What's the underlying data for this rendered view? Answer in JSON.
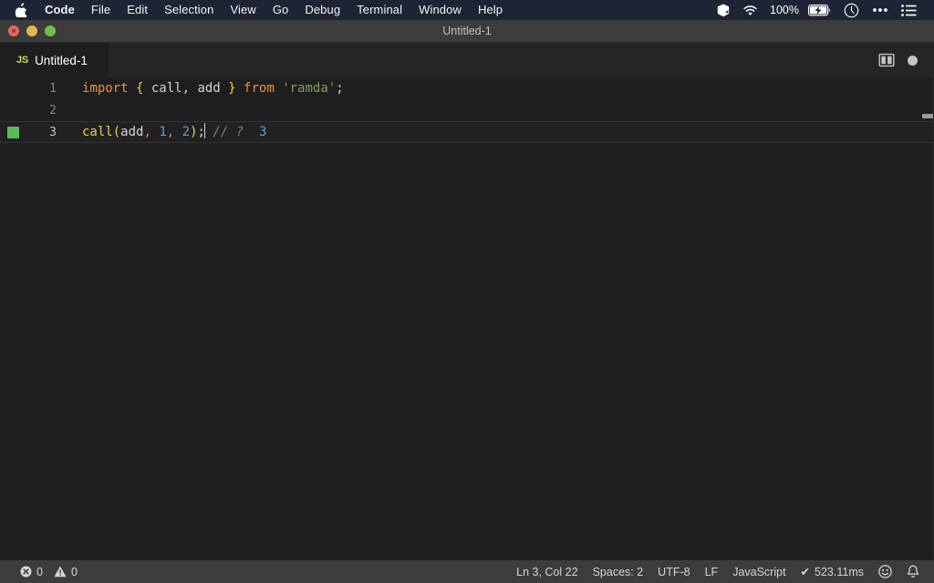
{
  "menubar": {
    "apple_icon": "apple-logo",
    "items": [
      {
        "label": "Code",
        "bold": true
      },
      {
        "label": "File",
        "bold": false
      },
      {
        "label": "Edit",
        "bold": false
      },
      {
        "label": "Selection",
        "bold": false
      },
      {
        "label": "View",
        "bold": false
      },
      {
        "label": "Go",
        "bold": false
      },
      {
        "label": "Debug",
        "bold": false
      },
      {
        "label": "Terminal",
        "bold": false
      },
      {
        "label": "Window",
        "bold": false
      },
      {
        "label": "Help",
        "bold": false
      }
    ],
    "status": {
      "dropbox_icon": "box-icon",
      "wifi_icon": "wifi-icon",
      "battery_percent": "100%",
      "battery_icon": "battery-charging-icon",
      "clock_icon": "time-machine-icon",
      "overflow_icon": "ellipsis-icon",
      "list_icon": "list-icon"
    }
  },
  "window": {
    "title": "Untitled-1",
    "traffic_lights": [
      "close",
      "minimize",
      "zoom"
    ]
  },
  "tabbar": {
    "tab": {
      "file_type": "JS",
      "label": "Untitled-1"
    },
    "actions": {
      "split_editor_icon": "split-editor-icon",
      "unsaved_dot": "unsaved-indicator-dot"
    }
  },
  "editor": {
    "lines": [
      {
        "number": "1",
        "has_marker": false,
        "active": false,
        "tokens": [
          {
            "text": "import",
            "type": "keyword"
          },
          {
            "text": " ",
            "type": "plain"
          },
          {
            "text": "{",
            "type": "brace"
          },
          {
            "text": " call, add ",
            "type": "plain"
          },
          {
            "text": "}",
            "type": "brace"
          },
          {
            "text": " ",
            "type": "plain"
          },
          {
            "text": "from",
            "type": "keyword"
          },
          {
            "text": " ",
            "type": "plain"
          },
          {
            "text": "'ramda'",
            "type": "string"
          },
          {
            "text": ";",
            "type": "semi"
          }
        ]
      },
      {
        "number": "2",
        "has_marker": false,
        "active": false,
        "tokens": []
      },
      {
        "number": "3",
        "has_marker": true,
        "active": true,
        "tokens": [
          {
            "text": "call",
            "type": "func"
          },
          {
            "text": "(",
            "type": "punct"
          },
          {
            "text": "add",
            "type": "plain"
          },
          {
            "text": ",",
            "type": "comma"
          },
          {
            "text": " ",
            "type": "plain"
          },
          {
            "text": "1",
            "type": "number"
          },
          {
            "text": ",",
            "type": "comma"
          },
          {
            "text": " ",
            "type": "plain"
          },
          {
            "text": "2",
            "type": "number"
          },
          {
            "text": ")",
            "type": "punct"
          },
          {
            "text": ";",
            "type": "semi"
          },
          {
            "text": " ",
            "type": "plain"
          },
          {
            "text": "// ?",
            "type": "comment"
          },
          {
            "text": "  ",
            "type": "plain"
          },
          {
            "text": "3",
            "type": "result"
          }
        ]
      }
    ]
  },
  "statusbar": {
    "errors_icon": "error-circle-icon",
    "errors_count": "0",
    "warnings_icon": "warning-triangle-icon",
    "warnings_count": "0",
    "cursor_position": "Ln 3, Col 22",
    "indentation": "Spaces: 2",
    "encoding": "UTF-8",
    "eol": "LF",
    "language": "JavaScript",
    "runtime_check": "✔",
    "runtime_time": "523.11ms",
    "feedback_icon": "smiley-icon",
    "notifications_icon": "bell-icon"
  },
  "colors": {
    "menubar_bg": "#1d2433",
    "titlebar_bg": "#3c3c3c",
    "tabbar_bg": "#252526",
    "editor_bg": "#1e1e1e",
    "statusbar_bg": "#3c3c3c",
    "keyword": "#e8923a",
    "string": "#7ba05b",
    "number": "#4ea0e0",
    "marker_green": "#5bb85b",
    "js_yellow": "#d7da4e"
  }
}
